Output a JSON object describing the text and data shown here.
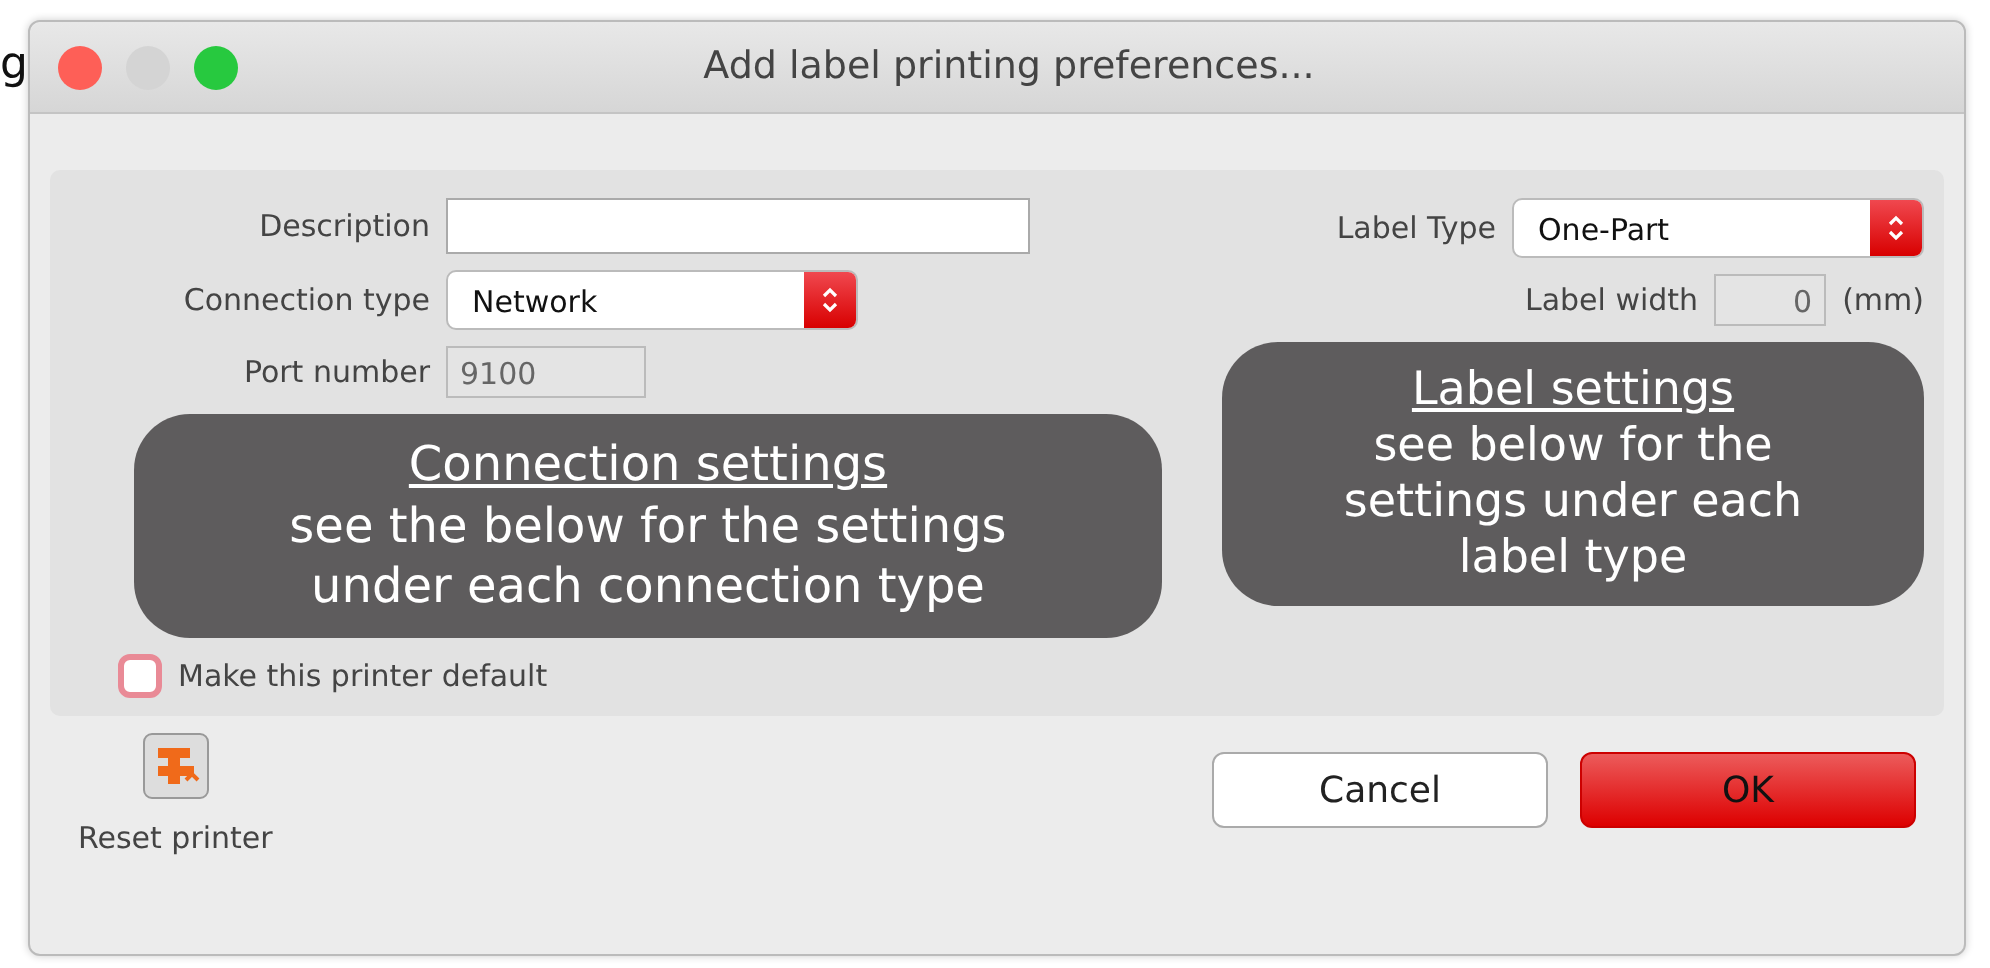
{
  "background_text": "g",
  "window": {
    "title": "Add label printing preferences..."
  },
  "connection": {
    "description": {
      "label": "Description"
    },
    "connection_type": {
      "label": "Connection type",
      "value": "Network"
    },
    "port_number": {
      "label": "Port number",
      "value": "9100"
    },
    "overlay": {
      "heading": "Connection settings",
      "lines": [
        "see the below for the settings",
        "under each connection type"
      ]
    }
  },
  "label": {
    "label_type": {
      "label": "Label Type",
      "value": "One-Part"
    },
    "label_width": {
      "label": "Label width",
      "value": "0",
      "unit": "(mm)"
    },
    "overlay": {
      "heading": "Label settings",
      "lines": [
        "see below for the",
        "settings under each",
        "label type"
      ]
    }
  },
  "default_checkbox": {
    "label": "Make this printer default",
    "checked": false
  },
  "reset": {
    "label": "Reset printer"
  },
  "buttons": [
    {
      "label": "Cancel",
      "kind": "secondary"
    },
    {
      "label": "OK",
      "kind": "primary"
    }
  ]
}
